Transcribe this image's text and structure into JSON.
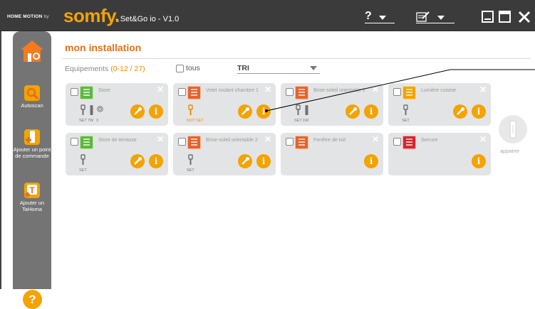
{
  "titlebar": {
    "brand_small": "HOME MOTION",
    "brand_by": "by",
    "logo": "somfy.",
    "app_title": "- Set&Go io - V1.0",
    "help_label": "?",
    "edit_icon": "edit-note-icon",
    "colors": {
      "bar": "#3b3b3b",
      "logo": "#f4a300"
    }
  },
  "sidebar": {
    "autoscan": "Autoscan",
    "add_point": "Ajouter un point de commande",
    "add_tahoma": "Ajouter un TaHoma",
    "help": "?"
  },
  "main": {
    "title": "mon installation",
    "equipments_label": "Equipements",
    "equipments_range": "(0-12 / 27)",
    "tous_label": "tous",
    "sort_value": "TRI"
  },
  "cards": [
    {
      "name": "Store",
      "tools": [
        {
          "type": "key",
          "label": "SET"
        },
        {
          "type": "remote",
          "label": "7W"
        },
        {
          "type": "sensor",
          "label": "3"
        }
      ],
      "has_wrench": true,
      "icon": "awning-icon",
      "icon_color": "#5cb83c"
    },
    {
      "name": "Volet roulant chambre 1",
      "tools": [
        {
          "type": "key",
          "label": "NOT SET",
          "notset": true
        }
      ],
      "has_wrench": true,
      "icon": "roller-shutter-icon",
      "icon_color": "#e8622a"
    },
    {
      "name": "Brise-soleil orientable 1",
      "tools": [
        {
          "type": "key",
          "label": "SET"
        },
        {
          "type": "remote",
          "label": "1W"
        }
      ],
      "has_wrench": true,
      "icon": "venetian-blind-icon",
      "icon_color": "#e8622a"
    },
    {
      "name": "Lumière cuisine",
      "tools": [
        {
          "type": "key",
          "label": "SET"
        }
      ],
      "has_wrench": true,
      "icon": "light-bulb-icon",
      "icon_color": "#f4a300"
    },
    {
      "name": "Store de terrasse",
      "tools": [
        {
          "type": "key",
          "label": "SET"
        }
      ],
      "has_wrench": true,
      "icon": "awning-icon",
      "icon_color": "#5cb83c"
    },
    {
      "name": "Brise-soleil orientable 2",
      "tools": [
        {
          "type": "key",
          "label": "SET"
        }
      ],
      "has_wrench": true,
      "icon": "venetian-blind-icon",
      "icon_color": "#e8622a"
    },
    {
      "name": "Fenêtre de toit",
      "tools": [],
      "has_wrench": false,
      "icon": "roof-window-icon",
      "icon_color": "#e8622a"
    },
    {
      "name": "Serrure",
      "tools": [],
      "has_wrench": false,
      "icon": "lock-icon",
      "icon_color": "#d9242f"
    }
  ],
  "appairer": {
    "label": "appairer"
  }
}
